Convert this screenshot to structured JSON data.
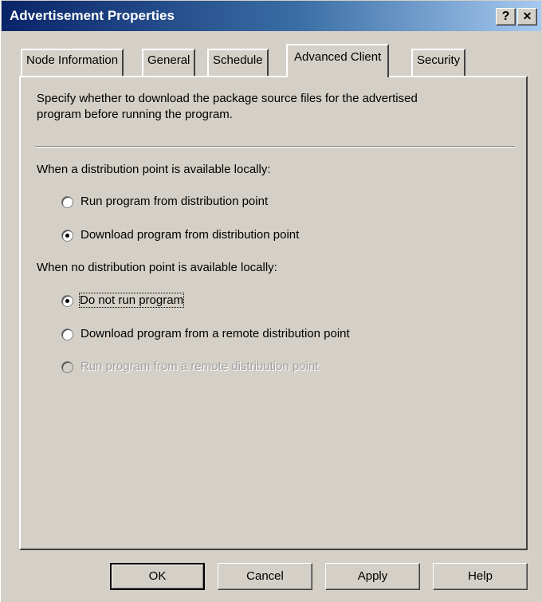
{
  "window": {
    "title": "Advertisement Properties",
    "help_btn": "?",
    "close_btn": "✕"
  },
  "tabs": [
    {
      "label": "Node Information"
    },
    {
      "label": "General"
    },
    {
      "label": "Schedule"
    },
    {
      "label": "Advanced Client",
      "active": true
    },
    {
      "label": "Security"
    }
  ],
  "panel": {
    "description_line1": "Specify whether to download the package source files for the advertised",
    "description_line2": "program before running the program.",
    "group1_label": "When a distribution point is available locally:",
    "group1_options": [
      {
        "label": "Run program from distribution point",
        "selected": false
      },
      {
        "label": "Download program from distribution point",
        "selected": true
      }
    ],
    "group2_label": "When no distribution point is available locally:",
    "group2_options": [
      {
        "label": "Do not run program",
        "selected": true,
        "focused": true
      },
      {
        "label": "Download program from a remote distribution point",
        "selected": false
      },
      {
        "label": "Run program from a remote distribution point",
        "selected": false,
        "disabled": true
      }
    ]
  },
  "buttons": {
    "ok": "OK",
    "cancel": "Cancel",
    "apply": "Apply",
    "help": "Help"
  }
}
